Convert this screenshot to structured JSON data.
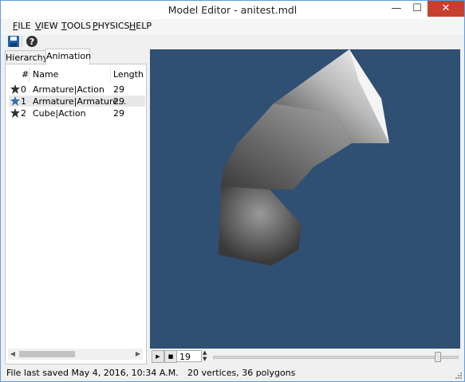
{
  "window": {
    "title": "Model Editor - anitest.mdl",
    "minimize_glyph": "—",
    "maximize_glyph": "☐",
    "close_glyph": "✕"
  },
  "menu": [
    "FILE",
    "VIEW",
    "TOOLS",
    "PHYSICS",
    "HELP"
  ],
  "toolbar": {
    "icons": [
      "save-icon",
      "help-icon"
    ]
  },
  "tabs": [
    {
      "label": "Hierarchy",
      "active": false
    },
    {
      "label": "Animation",
      "active": true
    }
  ],
  "animation_list": {
    "columns": [
      "#",
      "Name",
      "Length"
    ],
    "rows": [
      {
        "index": "0",
        "name": "Armature|Action",
        "length": "29",
        "selected": false
      },
      {
        "index": "1",
        "name": "Armature|Armature...",
        "length": "29",
        "selected": true
      },
      {
        "index": "2",
        "name": "Cube|Action",
        "length": "29",
        "selected": false
      }
    ]
  },
  "playback": {
    "play_glyph": "▶",
    "stop_glyph": "■",
    "frame": "19",
    "slider_fraction": 0.92
  },
  "status": {
    "saved": "File last saved May 4, 2016, 10:34 A.M.",
    "geometry": "20 vertices, 36 polygons"
  },
  "colors": {
    "viewport_bg": "#2f4f73",
    "selection": "#e8e8e8",
    "close_button": "#c7402f"
  }
}
